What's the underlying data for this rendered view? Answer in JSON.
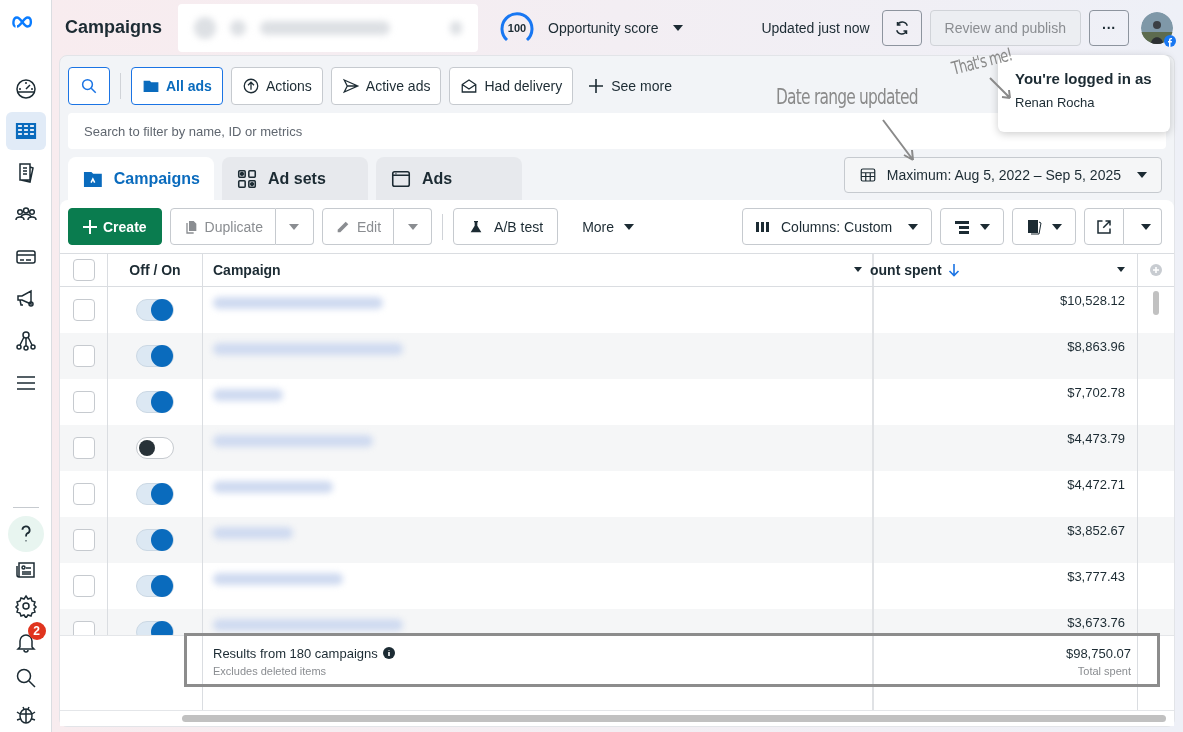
{
  "sidebar": {
    "nav_items": [
      {
        "selected": false
      },
      {
        "selected": true
      },
      {
        "selected": false
      },
      {
        "selected": false
      },
      {
        "selected": false
      },
      {
        "selected": false
      },
      {
        "selected": false
      },
      {
        "selected": false
      }
    ],
    "bottom_items": [
      {
        "selected": true
      },
      {
        "selected": false
      },
      {
        "selected": false
      },
      {
        "selected": false
      },
      {
        "selected": false
      },
      {
        "selected": false
      }
    ],
    "notifications_badge": "2"
  },
  "header": {
    "title": "Campaigns",
    "opportunity_score": {
      "value": "100",
      "label": "Opportunity score"
    },
    "updated": "Updated just now",
    "publish_button": {
      "label": "Review and publish",
      "disabled": true
    },
    "more_button": "···"
  },
  "filters": {
    "items": [
      {
        "label": "All ads",
        "selected": true
      },
      {
        "label": "Actions",
        "selected": false
      },
      {
        "label": "Active ads",
        "selected": false
      },
      {
        "label": "Had delivery",
        "selected": false
      }
    ],
    "see_more": "See more"
  },
  "search": {
    "placeholder": "Search to filter by name, ID or metrics"
  },
  "level_tabs": [
    {
      "label": "Campaigns",
      "selected": true
    },
    {
      "label": "Ad sets",
      "selected": false
    },
    {
      "label": "Ads",
      "selected": false
    }
  ],
  "date_range": "Maximum: Aug 5, 2022 – Sep 5, 2025",
  "toolbar": {
    "create": "Create",
    "duplicate": {
      "label": "Duplicate",
      "disabled": true
    },
    "edit": {
      "label": "Edit",
      "disabled": true
    },
    "ab_test": "A/B test",
    "more": "More",
    "columns": "Columns: Custom"
  },
  "table": {
    "select_all": false,
    "columns": [
      "Off / On",
      "Campaign",
      "ount spent"
    ],
    "rows": [
      {
        "checked": false,
        "on": true,
        "amount": "$10,528.12"
      },
      {
        "checked": false,
        "on": true,
        "amount": "$8,863.96"
      },
      {
        "checked": false,
        "on": true,
        "amount": "$7,702.78"
      },
      {
        "checked": false,
        "on": false,
        "amount": "$4,473.79"
      },
      {
        "checked": false,
        "on": true,
        "amount": "$4,472.71"
      },
      {
        "checked": false,
        "on": true,
        "amount": "$3,852.67"
      },
      {
        "checked": false,
        "on": true,
        "amount": "$3,777.43"
      },
      {
        "checked": false,
        "on": true,
        "amount": "$3,673.76"
      }
    ]
  },
  "footer": {
    "results": "Results from 180 campaigns",
    "note": "Excludes deleted items",
    "total": "$98,750.07",
    "total_label": "Total spent"
  },
  "login_tooltip": {
    "title": "You're logged in as",
    "name": "Renan Rocha"
  },
  "annotations": [
    {
      "text": "Date range updated"
    },
    {
      "text": "That's me!"
    }
  ]
}
